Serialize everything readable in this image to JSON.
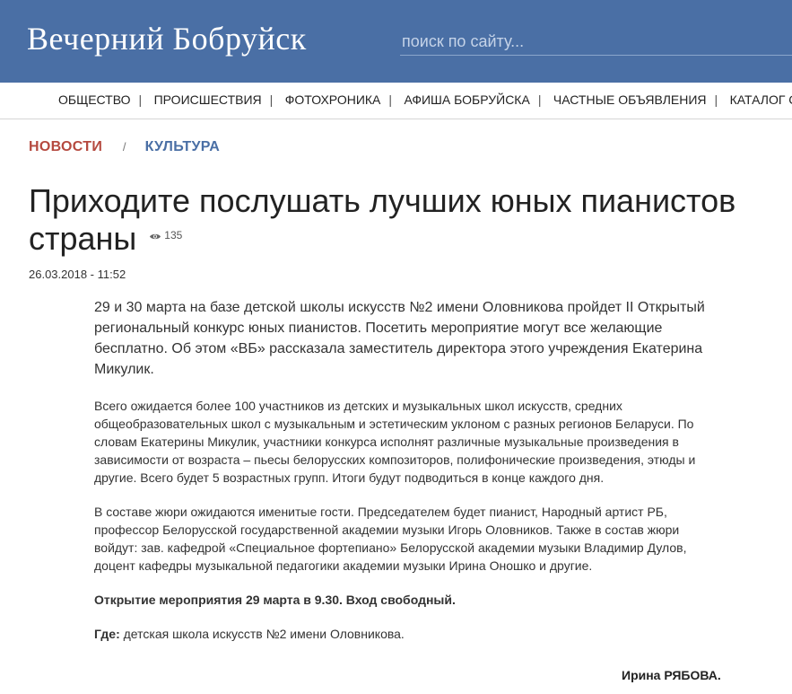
{
  "header": {
    "logo": "Вечерний Бобруйск",
    "search_placeholder": "поиск по сайту..."
  },
  "nav": {
    "items": [
      "ОБЩЕСТВО",
      "ПРОИСШЕСТВИЯ",
      "ФОТОХРОНИКА",
      "АФИША БОБРУЙСКА",
      "ЧАСТНЫЕ ОБЪЯВЛЕНИЯ",
      "КАТАЛОГ С"
    ],
    "separator": "|"
  },
  "breadcrumb": {
    "section": "НОВОСТИ",
    "separator": "/",
    "category": "КУЛЬТУРА"
  },
  "article": {
    "title": "Приходите послушать лучших юных пианистов страны",
    "views": "135",
    "date": "26.03.2018 - 11:52",
    "lead": "29 и 30 марта на базе детской школы искусств №2 имени Оловникова пройдет II Открытый региональный конкурс юных пианистов. Посетить мероприятие могут все желающие бесплатно. Об этом «ВБ» рассказала заместитель директора этого учреждения Екатерина Микулик.",
    "paragraph1": "Всего ожидается более 100 участников из детских и музыкальных школ искусств, средних общеобразовательных школ с музыкальным и эстетическим уклоном с разных регионов Беларуси. По словам Екатерины Микулик, участники конкурса исполнят различные музыкальные произведения в зависимости от возраста – пьесы белорусских композиторов, полифонические произведения, этюды и другие. Всего будет 5 возрастных групп. Итоги будут подводиться в конце каждого дня.",
    "paragraph2": "В составе жюри ожидаются именитые гости. Председателем будет пианист, Народный артист РБ, профессор Белорусской государственной академии музыки Игорь Оловников. Также в состав жюри войдут: зав. кафедрой «Специальное фортепиано» Белорусской академии музыки Владимир Дулов, доцент кафедры музыкальной педагогики академии музыки Ирина Оношко и другие.",
    "opening": "Открытие мероприятия 29 марта в 9.30. Вход свободный.",
    "where_label": "Где:",
    "where_value": " детская школа искусств №2 имени Оловникова.",
    "author": "Ирина РЯБОВА."
  },
  "colors": {
    "header_bg": "#4a6fa5",
    "breadcrumb_section": "#b5493f",
    "breadcrumb_category": "#4a6fa5"
  },
  "icons": {
    "views": "eye-icon"
  }
}
